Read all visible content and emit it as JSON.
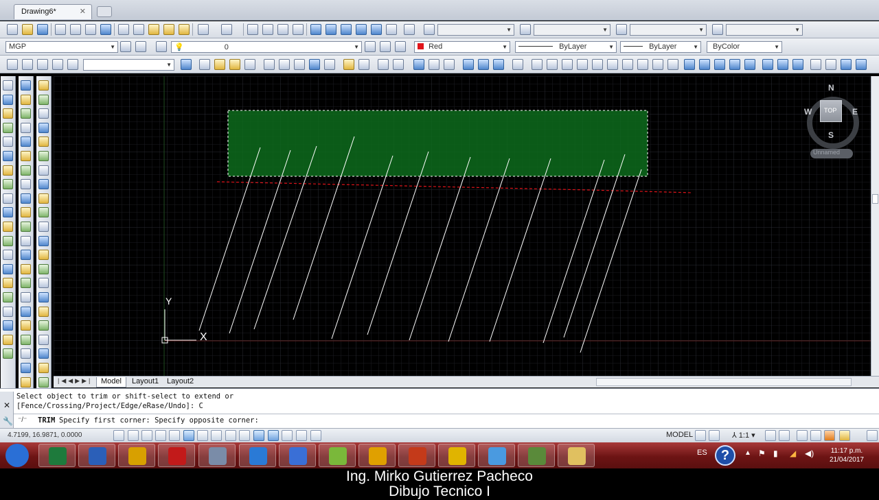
{
  "document_tab": {
    "title": "Drawing6*"
  },
  "toolbar2": {
    "workspace": "MGP",
    "layer_value": "0",
    "color_value": "Red",
    "linetype_value": "ByLayer",
    "lineweight_value": "ByLayer",
    "plotstyle_value": "ByColor"
  },
  "colors": {
    "accent_red": "#e0141a",
    "hatch_green": "#0d6b1c",
    "layer_bg": "#000000"
  },
  "layout_tabs": {
    "tabs": [
      "Model",
      "Layout1",
      "Layout2"
    ],
    "active": "Model"
  },
  "command_line": {
    "history_1": "Select object to trim or shift-select to extend or",
    "history_2": "[Fence/Crossing/Project/Edge/eRase/Undo]: C",
    "prompt_cmd": "TRIM",
    "prompt_text": "Specify first corner: Specify opposite corner:"
  },
  "statusbar": {
    "coords": "4.7199, 16.9871, 0.0000",
    "model_label": "MODEL",
    "scale_label": "1:1"
  },
  "viewcube": {
    "north": "N",
    "south": "S",
    "east": "E",
    "west": "W",
    "top": "TOP",
    "coord_system": "Unnamed"
  },
  "ucs": {
    "y_label": "Y",
    "x_label": "X"
  },
  "tray": {
    "language": "ES",
    "time": "11:17 p.m.",
    "date": "21/04/2017"
  },
  "caption": {
    "line1": "Ing. Mirko Gutierrez Pacheco",
    "line2": "Dibujo Tecnico I"
  },
  "taskbar_apps": [
    "start-orb",
    "excel",
    "word",
    "app-orange",
    "autocad",
    "app-printer",
    "app-globe",
    "app-blue",
    "app-green",
    "app-chrome-canary",
    "app-alert",
    "chrome",
    "app-video",
    "app-plant",
    "app-folder"
  ]
}
